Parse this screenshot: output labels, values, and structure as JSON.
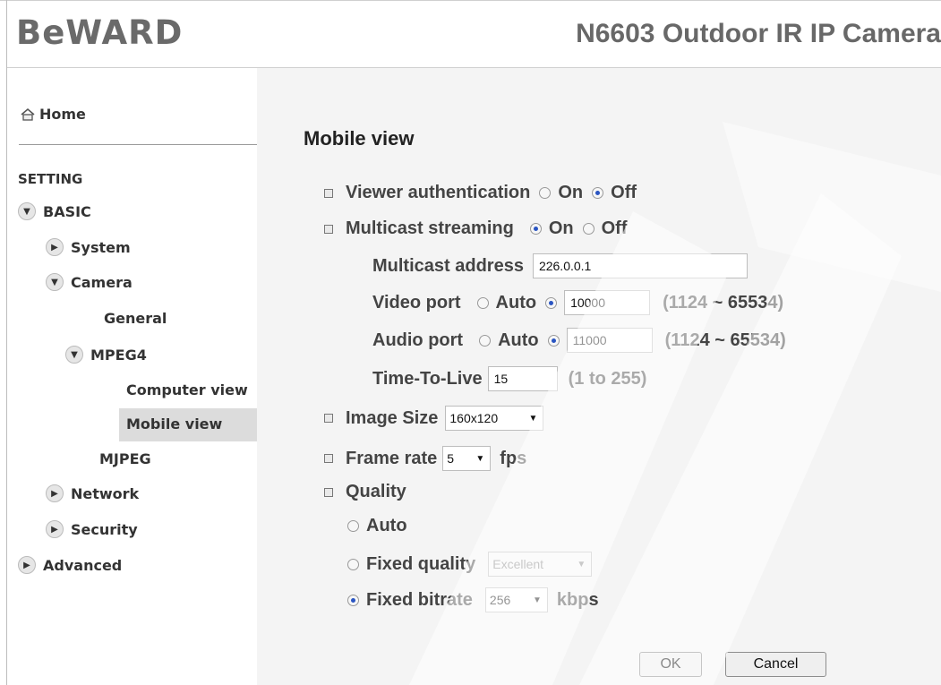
{
  "header": {
    "logo": "BeWARD",
    "product": "N6603 Outdoor IR IP Camera"
  },
  "sidebar": {
    "home": "Home",
    "section": "SETTING",
    "items": {
      "basic": "BASIC",
      "system": "System",
      "camera": "Camera",
      "general": "General",
      "mpeg4": "MPEG4",
      "computer_view": "Computer view",
      "mobile_view": "Mobile view",
      "mjpeg": "MJPEG",
      "network": "Network",
      "security": "Security",
      "advanced": "Advanced"
    }
  },
  "main": {
    "title": "Mobile view",
    "viewer_auth": {
      "label": "Viewer authentication",
      "on": "On",
      "off": "Off",
      "selected": "Off"
    },
    "multicast": {
      "label": "Multicast streaming",
      "on": "On",
      "off": "Off",
      "selected": "On"
    },
    "multicast_address": {
      "label": "Multicast address",
      "value": "226.0.0.1"
    },
    "video_port": {
      "label": "Video port",
      "auto": "Auto",
      "value": "10000",
      "range": "(1124 ~ 65534)",
      "selected": "manual"
    },
    "audio_port": {
      "label": "Audio port",
      "auto": "Auto",
      "value": "11000",
      "range": "(1124 ~ 65534)",
      "selected": "manual"
    },
    "ttl": {
      "label": "Time-To-Live",
      "value": "15",
      "range": "(1 to 255)"
    },
    "image_size": {
      "label": "Image Size",
      "value": "160x120"
    },
    "frame_rate": {
      "label": "Frame rate",
      "value": "5",
      "unit": "fps"
    },
    "quality": {
      "label": "Quality",
      "auto": "Auto",
      "fixed_quality": "Fixed quality",
      "fixed_quality_value": "Excellent",
      "fixed_bitrate": "Fixed bitrate",
      "fixed_bitrate_value": "256",
      "bitrate_unit": "kbps",
      "selected": "Fixed bitrate"
    },
    "buttons": {
      "ok": "OK",
      "cancel": "Cancel"
    }
  },
  "colors": {
    "header_text": "#686868",
    "content_bg": "#f4f4f4",
    "active_nav_bg": "#dcdcdc",
    "radio_selected": "#2a55c2"
  },
  "icons": [
    "home-icon",
    "arrow-down-icon",
    "arrow-right-icon",
    "bullet-square-icon",
    "radio-icon",
    "dropdown-caret-icon"
  ]
}
